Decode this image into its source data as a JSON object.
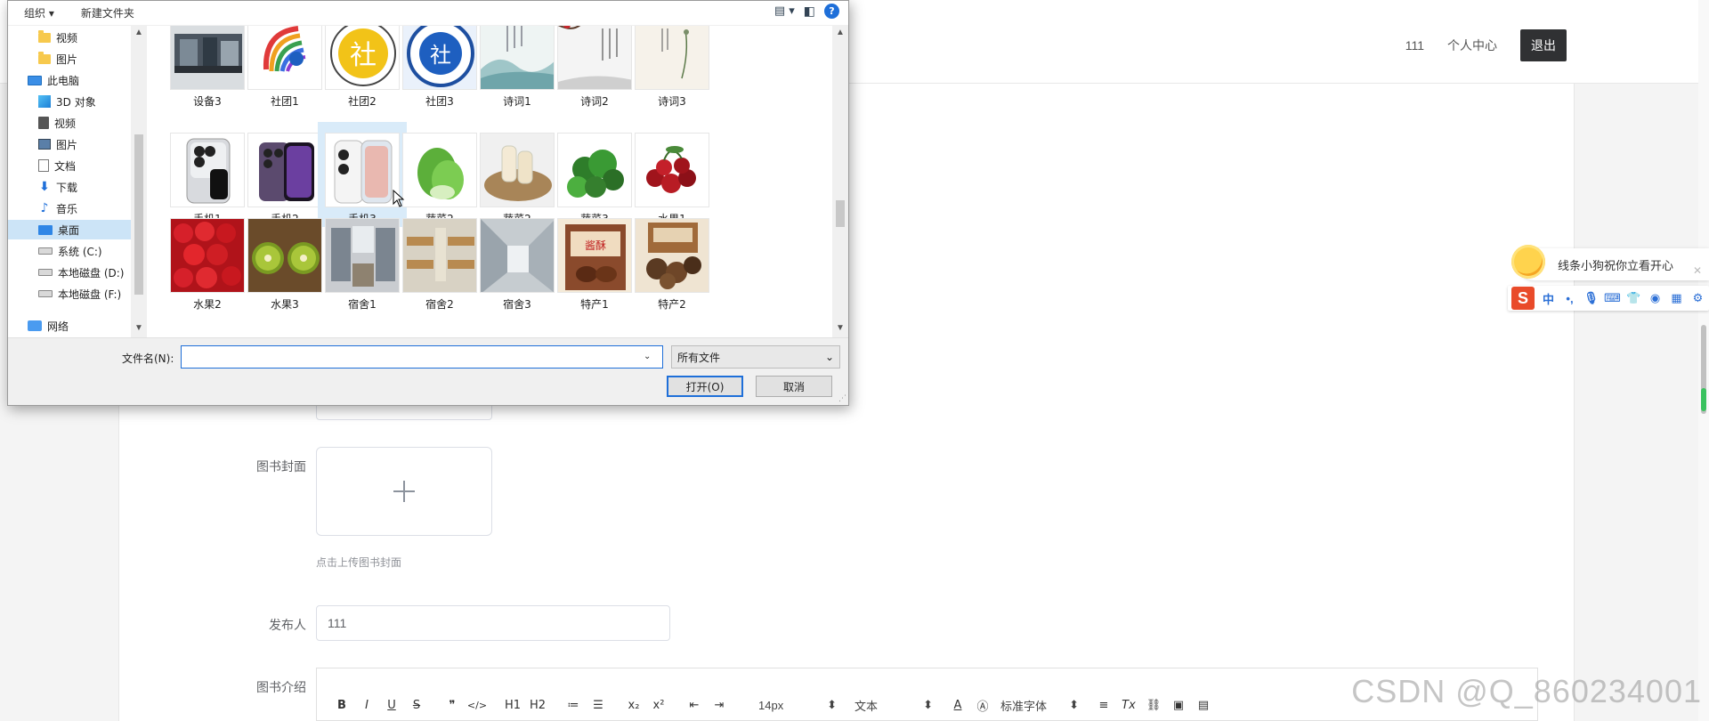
{
  "web": {
    "nav": {
      "user": "111",
      "profile": "个人中心",
      "logout": "退出"
    },
    "form": {
      "cover_label": "图书封面",
      "cover_hint": "点击上传图书封面",
      "publisher_label": "发布人",
      "publisher_value": "111",
      "intro_label": "图书介绍"
    },
    "editor_toolbar": {
      "buttons": [
        "B",
        "I",
        "U",
        "S",
        "❞",
        "</>",
        "H1",
        "H2",
        "≔",
        "☰",
        "x₂",
        "x²",
        "⇤",
        "⇥"
      ],
      "font_size": "14px",
      "block_type": "文本",
      "font_family": "标准字体",
      "extra": [
        "≡",
        "Tx",
        "🔗",
        "▣",
        "▤"
      ]
    },
    "watermark": "CSDN @Q_860234001"
  },
  "ime": {
    "tip": "线条小狗祝你立看开心",
    "close": "✕",
    "logo": "S",
    "mode": "中",
    "icons": [
      "punct-icon",
      "mic-icon",
      "keyboard-icon",
      "skin-icon",
      "game-icon",
      "apps-icon",
      "settings-icon"
    ]
  },
  "dialog": {
    "toolbar": {
      "organize": "组织 ▾",
      "new_folder": "新建文件夹",
      "help": "?"
    },
    "nav": [
      {
        "label": "视频",
        "icon": "folder-icon"
      },
      {
        "label": "图片",
        "icon": "folder-icon"
      },
      {
        "label": "此电脑",
        "icon": "pc-icon"
      },
      {
        "label": "3D 对象",
        "icon": "3d-objects-icon"
      },
      {
        "label": "视频",
        "icon": "videos-icon"
      },
      {
        "label": "图片",
        "icon": "pictures-icon"
      },
      {
        "label": "文档",
        "icon": "documents-icon"
      },
      {
        "label": "下载",
        "icon": "download-icon"
      },
      {
        "label": "音乐",
        "icon": "music-icon"
      },
      {
        "label": "桌面",
        "icon": "desktop-icon",
        "selected": true
      },
      {
        "label": "系统 (C:)",
        "icon": "drive-icon"
      },
      {
        "label": "本地磁盘 (D:)",
        "icon": "drive-icon"
      },
      {
        "label": "本地磁盘 (F:)",
        "icon": "drive-icon"
      },
      {
        "label": "网络",
        "icon": "network-icon"
      }
    ],
    "files": [
      {
        "name": "设备3",
        "thumb": "equipment"
      },
      {
        "name": "社团1",
        "thumb": "club-logo-rainbow"
      },
      {
        "name": "社团2",
        "thumb": "club-badge-yellow"
      },
      {
        "name": "社团3",
        "thumb": "club-badge-blue"
      },
      {
        "name": "诗词1",
        "thumb": "poem-landscape"
      },
      {
        "name": "诗词2",
        "thumb": "poem-plum"
      },
      {
        "name": "诗词3",
        "thumb": "poem-orchid"
      },
      {
        "name": "手机1",
        "thumb": "phone-silver"
      },
      {
        "name": "手机2",
        "thumb": "phone-purple"
      },
      {
        "name": "手机3",
        "thumb": "phone-white",
        "selected": true
      },
      {
        "name": "蔬菜2",
        "thumb": "bok-choy"
      },
      {
        "name": "蔬菜2",
        "thumb": "yam"
      },
      {
        "name": "蔬菜3",
        "thumb": "broccoli"
      },
      {
        "name": "水果1",
        "thumb": "cherries"
      },
      {
        "name": "水果2",
        "thumb": "strawberries"
      },
      {
        "name": "水果3",
        "thumb": "kiwi"
      },
      {
        "name": "宿舍1",
        "thumb": "dorm-room"
      },
      {
        "name": "宿舍2",
        "thumb": "dorm-beds"
      },
      {
        "name": "宿舍3",
        "thumb": "dorm-hall"
      },
      {
        "name": "特产1",
        "thumb": "specialty-box"
      },
      {
        "name": "特产2",
        "thumb": "specialty-mushroom"
      }
    ],
    "filename_label": "文件名(N):",
    "filename_value": "",
    "filetype": "所有文件",
    "open": "打开(O)",
    "cancel": "取消"
  }
}
